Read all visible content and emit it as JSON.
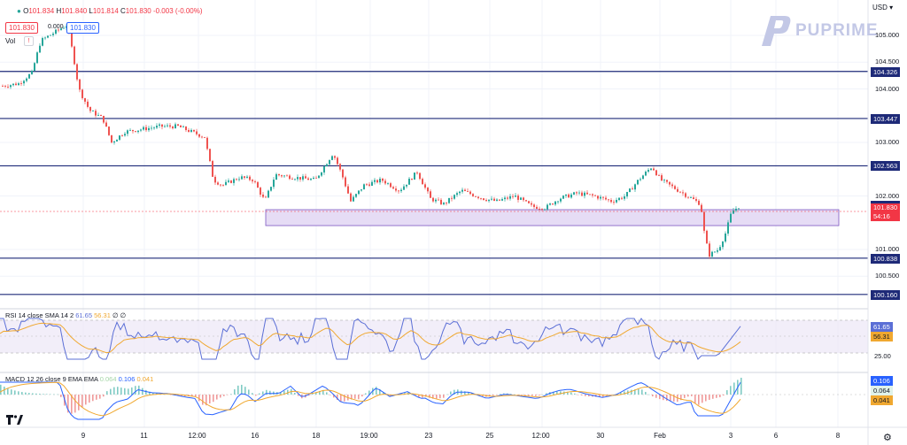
{
  "currency": "USD",
  "brand": "PUPRIME",
  "ohlc": {
    "o_label": "O",
    "o": "101.834",
    "h_label": "H",
    "h": "101.840",
    "l_label": "L",
    "l": "101.814",
    "c_label": "C",
    "c": "101.830",
    "chg": "-0.003 (-0.00%)"
  },
  "bid_box": "101.830",
  "mid_value": "0.000",
  "ask_box": "101.830",
  "vol_label": "Vol",
  "price_axis": {
    "ticks": [
      "105.000",
      "104.500",
      "104.000",
      "103.000",
      "102.000",
      "101.000",
      "100.500"
    ],
    "levels": [
      {
        "value": "104.326",
        "color": "#1e2a78"
      },
      {
        "value": "103.447",
        "color": "#1e2a78"
      },
      {
        "value": "102.563",
        "color": "#1e2a78"
      },
      {
        "value": "101.819",
        "color": "#1e2a78"
      },
      {
        "value": "100.838",
        "color": "#1e2a78"
      },
      {
        "value": "100.160",
        "color": "#1e2a78"
      }
    ],
    "last_price": "101.830",
    "countdown": "54:16"
  },
  "rsi": {
    "label": "RSI 14 close SMA 14 2",
    "rsi_value": "61.65",
    "sma_value": "56.31",
    "extra": "∅ ∅",
    "tick": "25.00"
  },
  "macd": {
    "label": "MACD 12 26 close 9 EMA EMA",
    "hist": "0.064",
    "macd": "0.106",
    "signal": "0.041"
  },
  "time_axis": [
    "9",
    "11",
    "12:00",
    "16",
    "18",
    "19:00",
    "23",
    "25",
    "12:00",
    "30",
    "Feb",
    "3",
    "6",
    "8"
  ],
  "colors": {
    "up": "#26a69a",
    "down": "#ef5350",
    "level": "#1e2a78",
    "zone": "#e6dcf5",
    "rsi_line": "#5b6fd6",
    "sma_line": "#f0a830",
    "macd_line": "#2962ff",
    "signal_line": "#f0a830"
  }
}
